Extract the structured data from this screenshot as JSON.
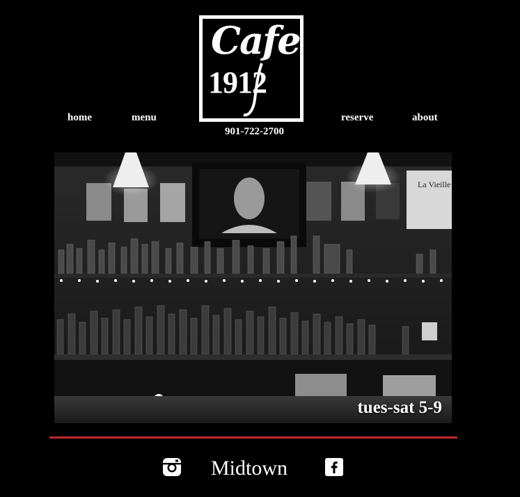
{
  "brand": {
    "logo_word": "Cafe",
    "logo_year": "1912"
  },
  "nav": {
    "home": "home",
    "menu": "menu",
    "reserve": "reserve",
    "about": "about"
  },
  "contact": {
    "phone": "901-722-2700"
  },
  "hero": {
    "hours": "tues-sat 5-9",
    "poster_text": "La Vieille F"
  },
  "footer": {
    "title": "Midtown",
    "icons": [
      "instagram-icon",
      "facebook-icon"
    ]
  },
  "colors": {
    "background": "#000000",
    "accent_divider": "#c1272d",
    "text": "#ffffff"
  }
}
